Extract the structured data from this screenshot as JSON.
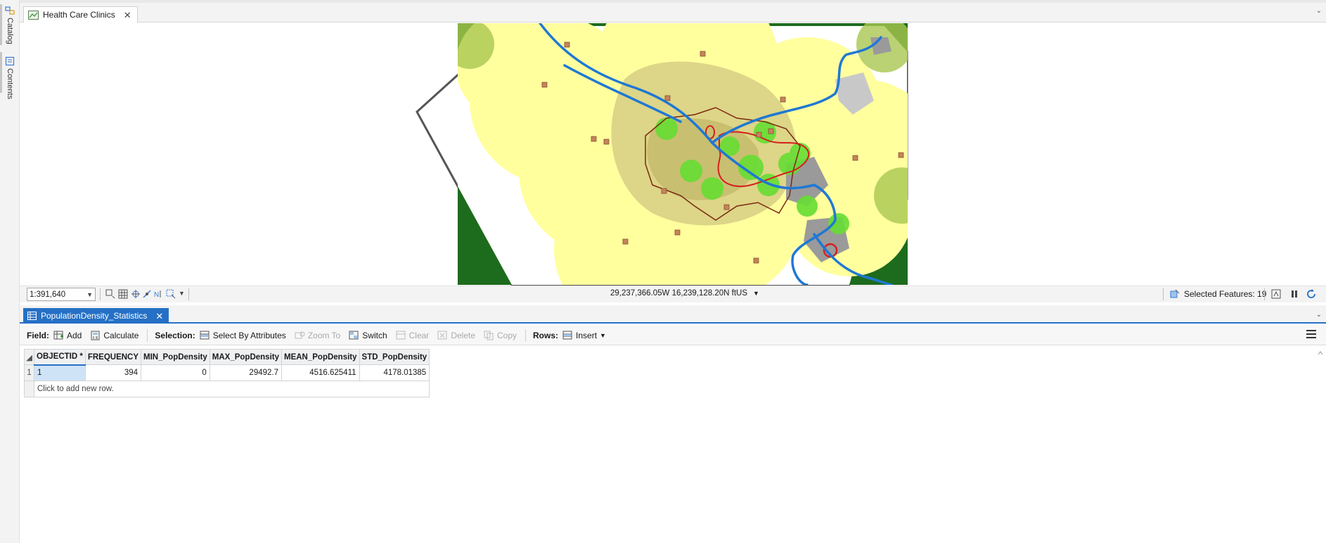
{
  "dock": {
    "catalog_label": "Catalog",
    "contents_label": "Contents"
  },
  "map_tab": {
    "title": "Health Care Clinics"
  },
  "map": {
    "colors": {
      "forest": "#1d6b1d",
      "buffer_yellow": "#ffff9e",
      "tract_tan": "#d7ce82",
      "city_outline": "#7a2a10",
      "river": "#1f78d4",
      "flood_red": "#d61f1f",
      "green_buffer": "#66dd33",
      "clinic_marker": "#c4835a",
      "county_outline": "#555555"
    }
  },
  "statusbar": {
    "scale": "1:391,640",
    "coordinates": "29,237,366.05W 16,239,128.20N ftUS",
    "selected_features": "Selected Features: 19"
  },
  "table_tab": {
    "title": "PopulationDensity_Statistics"
  },
  "table_toolbar": {
    "field_label": "Field:",
    "add": "Add",
    "calculate": "Calculate",
    "selection_label": "Selection:",
    "select_by_attributes": "Select By Attributes",
    "zoom_to": "Zoom To",
    "switch": "Switch",
    "clear": "Clear",
    "delete": "Delete",
    "copy": "Copy",
    "rows_label": "Rows:",
    "insert": "Insert"
  },
  "table": {
    "columns": [
      "OBJECTID *",
      "FREQUENCY",
      "MIN_PopDensity",
      "MAX_PopDensity",
      "MEAN_PopDensity",
      "STD_PopDensity"
    ],
    "rows": [
      {
        "row_number": "1",
        "cells": [
          "1",
          "394",
          "0",
          "29492.7",
          "4516.625411",
          "4178.01385"
        ]
      }
    ],
    "add_row_text": "Click to add new row."
  }
}
